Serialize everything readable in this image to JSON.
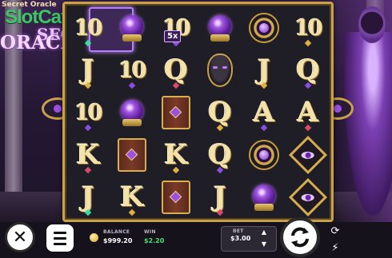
{
  "logo": {
    "small_title": "Secret Oracle",
    "brand": "SlotCatalog",
    "brand_suffix": "com",
    "game_line1": "SECRET",
    "game_line2": "ORACLE"
  },
  "reels": [
    [
      "10",
      "J",
      "10",
      "K",
      "J"
    ],
    [
      "orb",
      "10",
      "orb",
      "book",
      "K"
    ],
    [
      "10",
      "Q",
      "book",
      "K",
      "book"
    ],
    [
      "orb",
      "mask",
      "Q",
      "Q",
      "J"
    ],
    [
      "amulet",
      "J",
      "A",
      "amulet",
      "orb"
    ],
    [
      "10",
      "Q",
      "A",
      "eye-diamond",
      "eye-diamond"
    ]
  ],
  "highlight": {
    "multiplier": "5x"
  },
  "hud": {
    "balance_label": "BALANCE",
    "balance_value": "$999.20",
    "win_label": "WIN",
    "win_value": "$2.20",
    "bet_label": "BET",
    "bet_value": "$3.00"
  },
  "colors": {
    "frame_gold": "#c9a14a",
    "win_green": "#48e070",
    "highlight_purple": "#b77cff"
  },
  "icons": [
    "close-icon",
    "menu-icon",
    "coin-icon",
    "spin-icon",
    "autoplay-icon",
    "turbo-icon",
    "chevron-up-icon",
    "chevron-down-icon"
  ]
}
